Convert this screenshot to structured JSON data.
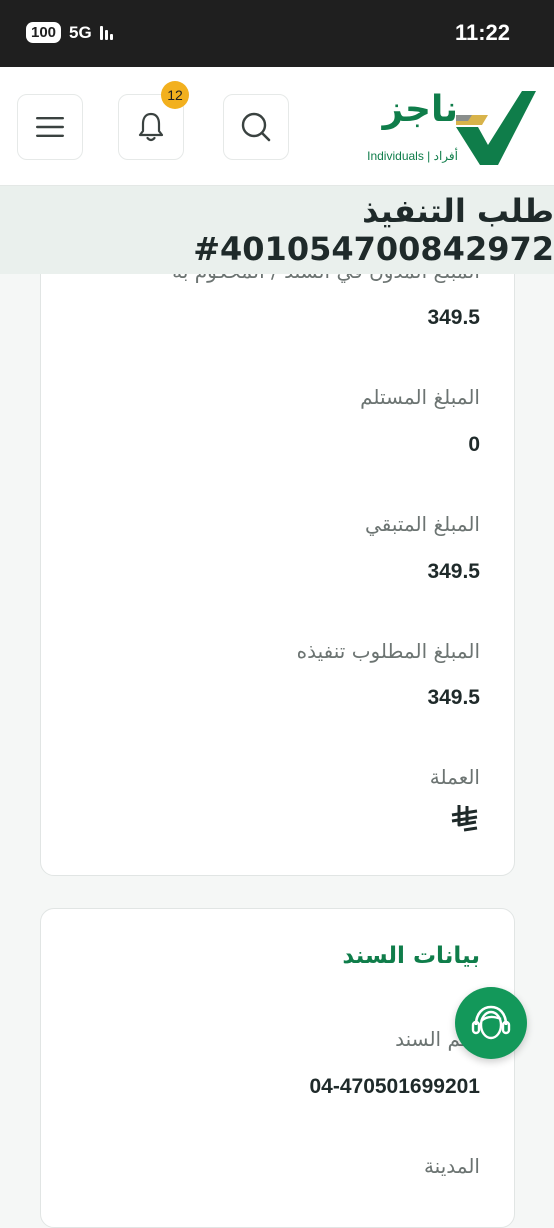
{
  "status_bar": {
    "battery": "100",
    "network": "5G",
    "time": "11:22"
  },
  "header": {
    "logo_name": "ناجز",
    "logo_subtitle": "Individuals | أفراد",
    "notification_count": "12"
  },
  "page_title": "طلب التنفيذ 401054700842972#",
  "amount_card": {
    "truncated_label": "المبلغ المدون في السند / المحكوم به",
    "truncated_value": "349.5",
    "received_label": "المبلغ المستلم",
    "received_value": "0",
    "remaining_label": "المبلغ المتبقي",
    "remaining_value": "349.5",
    "required_label": "المبلغ المطلوب تنفيذه",
    "required_value": "349.5",
    "currency_label": "العملة",
    "currency_icon": "saudi-riyal-icon"
  },
  "bond_card": {
    "title": "بيانات السند",
    "bond_number_label": "رقم السند",
    "bond_number_value": "04-470501699201",
    "city_label": "المدينة"
  },
  "colors": {
    "brand_green": "#0f7d4a",
    "badge": "#f2b01e",
    "fab": "#13985a"
  }
}
